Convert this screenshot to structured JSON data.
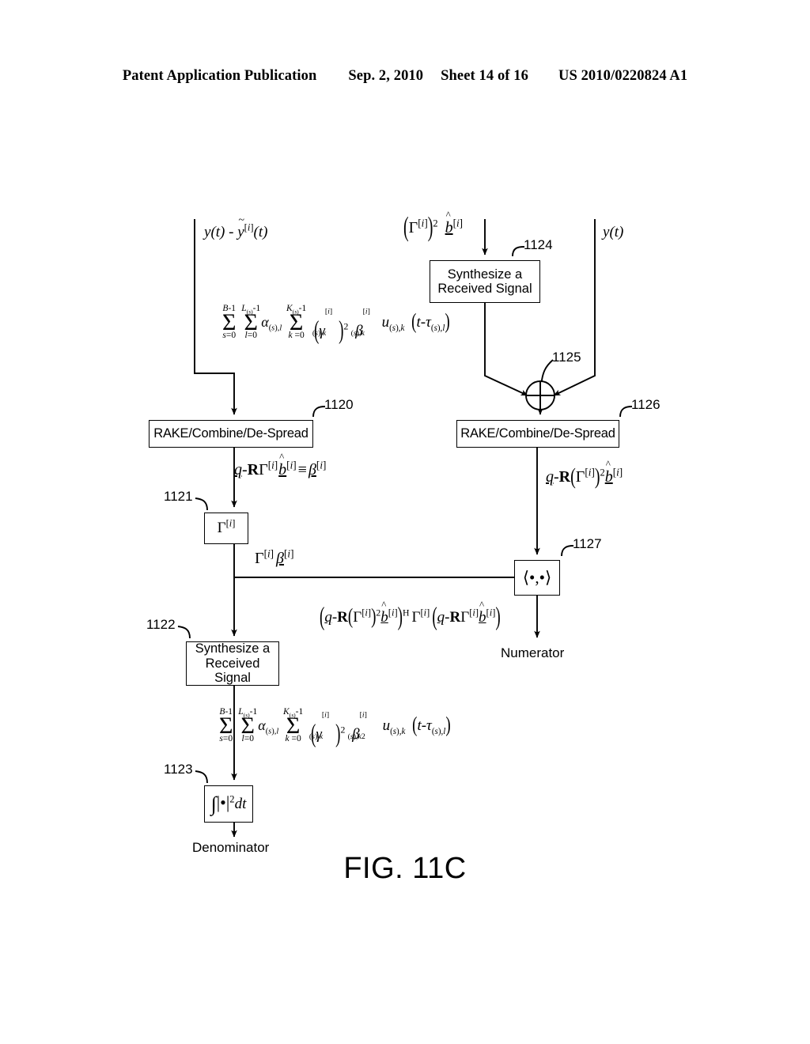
{
  "header": {
    "publication": "Patent Application Publication",
    "date": "Sep. 2, 2010",
    "sheet": "Sheet 14 of 16",
    "docnum": "US 2010/0220824 A1"
  },
  "figure": {
    "caption": "FIG. 11C",
    "boxes": {
      "b1120": {
        "ref": "1120",
        "label": "RAKE/Combine/De-Spread"
      },
      "b1126": {
        "ref": "1126",
        "label": "RAKE/Combine/De-Spread"
      },
      "b1124": {
        "ref": "1124",
        "line1": "Synthesize a",
        "line2": "Received Signal"
      },
      "b1122": {
        "ref": "1122",
        "line1": "Synthesize a",
        "line2": "Received Signal"
      },
      "b1121": {
        "ref": "1121",
        "label": "Γ[i]"
      },
      "b1123": {
        "ref": "1123",
        "label": "∫|•|2dt"
      },
      "b1127": {
        "ref": "1127",
        "label": "⟨•,•⟩"
      }
    },
    "junction": {
      "ref": "1125",
      "symbol": "summing-junction"
    },
    "signals": {
      "input_left": "y(t) - ỹ[i](t)",
      "input_mid": "(Γ[i])2 b̂[i]",
      "input_right": "y(t)",
      "left_rake_out": "q-RΓ[i]b̂[i] ≡ β[i]",
      "right_rake_out": "q-R(Γ[i])2 b̂[i]",
      "gamma_box_out": "Γ[i]β[i]",
      "numerator_expr": "(q-R(Γ[i])2b̂[i])H Γ[i] (q-RΓ[i]b̂[i])"
    },
    "summation_top": {
      "limits": [
        {
          "top": "B-1",
          "bottom": "s=0"
        },
        {
          "top": "L(s)-1",
          "bottom": "l=0"
        },
        {
          "top": "K(s)-1",
          "bottom": "k=0"
        }
      ],
      "terms": [
        "α(s),l",
        "(γ[i](s),k)2",
        "β[i](s),k",
        "u(s),k",
        "(t-τ(s),l)"
      ]
    },
    "summation_bottom": {
      "limits": [
        {
          "top": "B-1",
          "bottom": "s=0"
        },
        {
          "top": "L(s)-1",
          "bottom": "l=0"
        },
        {
          "top": "K(s)-1",
          "bottom": "k=0"
        }
      ],
      "terms": [
        "α(s),l",
        "(γ[i](s),k)2",
        "β[i](s),k2",
        "u(s),k",
        "(t-τ(s),l)"
      ]
    },
    "outputs": {
      "numerator": "Numerator",
      "denominator": "Denominator"
    }
  }
}
